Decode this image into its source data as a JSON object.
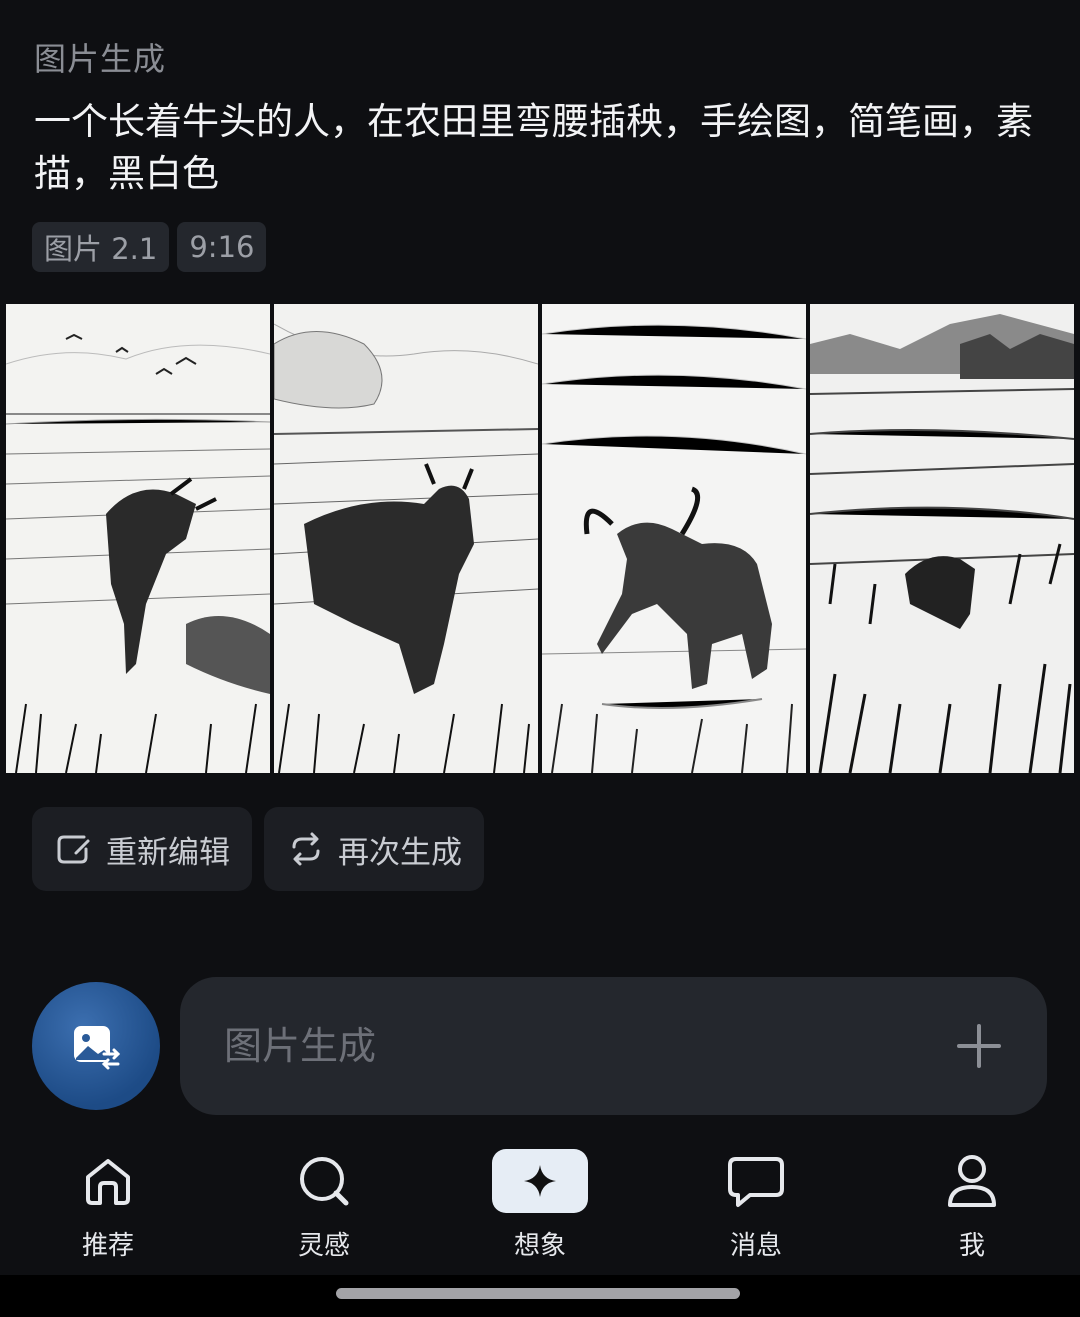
{
  "header": {
    "section_label": "图片生成"
  },
  "prompt": {
    "text": "一个长着牛头的人，在农田里弯腰插秧，手绘图，简笔画，素描，黑白色"
  },
  "tags": [
    "图片 2.1",
    "9:16"
  ],
  "images": [
    {
      "icon": "generated-image-1"
    },
    {
      "icon": "generated-image-2"
    },
    {
      "icon": "generated-image-3"
    },
    {
      "icon": "generated-image-4"
    }
  ],
  "actions": {
    "reedit_label": "重新编辑",
    "regenerate_label": "再次生成"
  },
  "input": {
    "placeholder": "图片生成"
  },
  "nav": {
    "home": "推荐",
    "inspiration": "灵感",
    "imagine": "想象",
    "messages": "消息",
    "me": "我"
  },
  "colors": {
    "background": "#0e0f12",
    "accent": "#2f63a8",
    "surface": "#24272d"
  }
}
